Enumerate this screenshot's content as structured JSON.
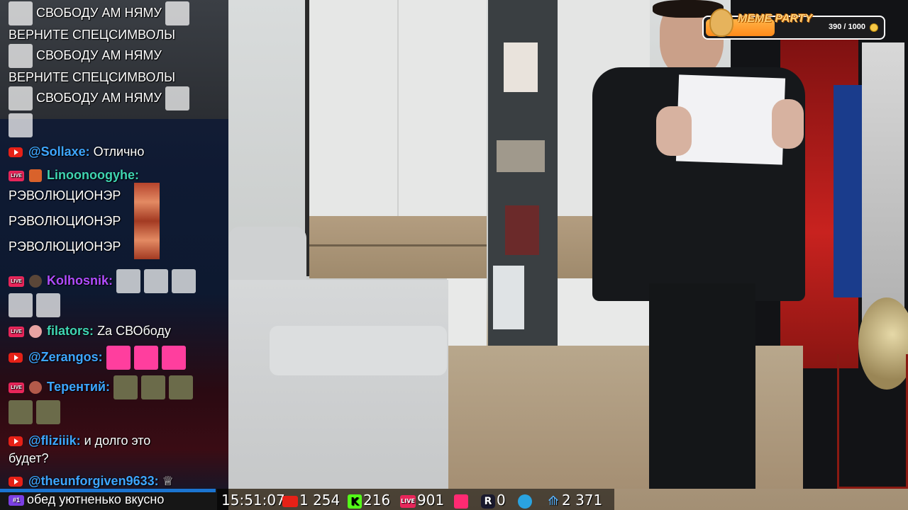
{
  "chat": {
    "messages": [
      {
        "text": "СВОБОДУ АМ НЯМУ"
      },
      {
        "text": "ВЕРНИТЕ СПЕЦСИМВОЛЫ"
      },
      {
        "text": "СВОБОДУ АМ НЯМУ"
      },
      {
        "text": "ВЕРНИТЕ СПЕЦСИМВОЛЫ"
      },
      {
        "text": "СВОБОДУ АМ НЯМУ"
      },
      {
        "user": "@Sollaxe:",
        "text": "Отлично",
        "user_color": "#3ea6ff"
      },
      {
        "user": "Linoonoogyhe:",
        "user_color": "#3fd4b2",
        "lines": [
          "РЭВОЛЮЦИОНЭР",
          "РЭВОЛЮЦИОНЭР",
          "РЭВОЛЮЦИОНЭР"
        ]
      },
      {
        "user": "Kolhosnik:",
        "user_color": "#b04cff"
      },
      {
        "user": "filators:",
        "text": "Za СВОбоду",
        "user_color": "#3fd4b2"
      },
      {
        "user": "@Zerangos:",
        "user_color": "#3ea6ff"
      },
      {
        "user": "Терентий:",
        "user_color": "#3ea6ff"
      },
      {
        "user": "@fliziiik:",
        "text": "и долго это",
        "text2": "будет?",
        "user_color": "#3ea6ff"
      },
      {
        "user": "@theunforgiven9633:",
        "user_color": "#3ea6ff"
      }
    ],
    "last_message": "обед уютненько вкусно",
    "last_badge": "#1"
  },
  "meme_party": {
    "title": "MEME PARTY",
    "count": "390 / 1000",
    "progress": 0.39
  },
  "stats": {
    "time": "15:51:07",
    "youtube": "1 254",
    "kick": "216",
    "vk_live": "901",
    "vk_play": "",
    "rutube": "0",
    "telegram": "",
    "viewers": "2 371"
  },
  "colors": {
    "youtube": "#e62117",
    "kick": "#53fc18",
    "live": "#e8265a",
    "twitch": "#7b3fe4",
    "highlight_blue": "#1b74d0"
  }
}
